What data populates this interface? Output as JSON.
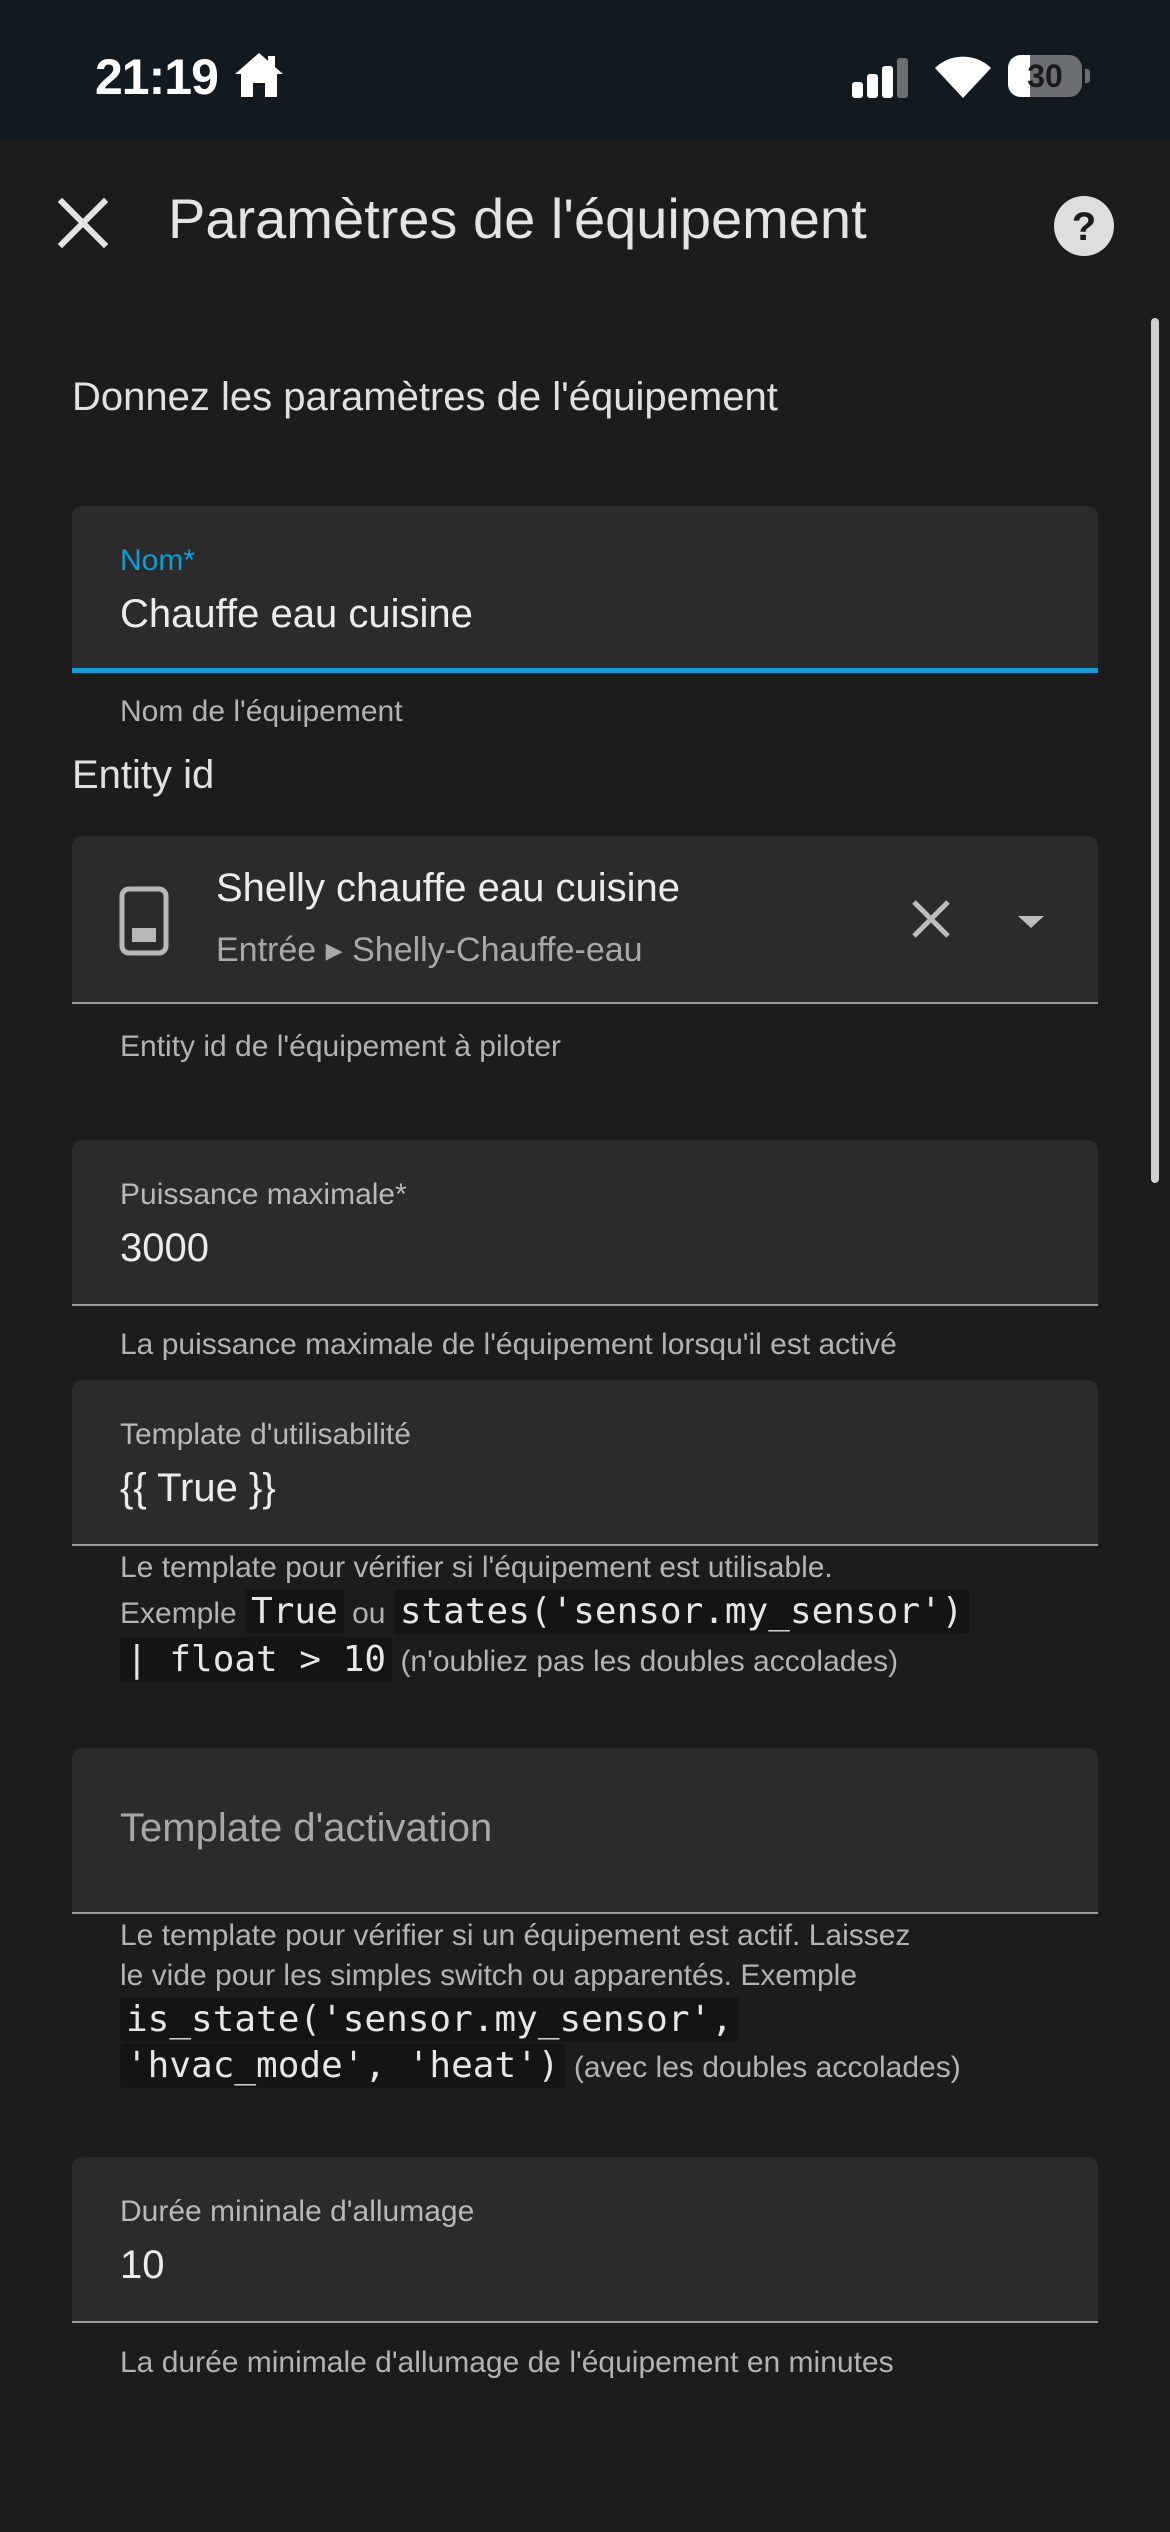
{
  "status": {
    "time": "21:19",
    "battery": "30",
    "battery_level": 0.3
  },
  "header": {
    "title": "Paramètres de l'équipement"
  },
  "form": {
    "section_title": "Donnez les paramètres de l'équipement",
    "name": {
      "label": "Nom*",
      "value": "Chauffe eau cuisine",
      "helper": "Nom de l'équipement"
    },
    "entity": {
      "title": "Entity id",
      "name": "Shelly chauffe eau cuisine",
      "subtitle": "Entrée ▸ Shelly-Chauffe-eau",
      "helper": "Entity id de l'équipement à piloter"
    },
    "power": {
      "label": "Puissance maximale*",
      "value": "3000",
      "helper": "La puissance maximale de l'équipement lorsqu'il est activé"
    },
    "usability": {
      "label": "Template d'utilisabilité",
      "value": "{{ True }}",
      "helper_line1": "Le template pour vérifier si l'équipement est utilisable.",
      "helper_example": "Exemple",
      "code1": "True",
      "helper_or": "ou",
      "code2": "states('sensor.my_sensor')",
      "code3": "| float > 10",
      "helper_tail": "(n'oubliez pas les doubles accolades)"
    },
    "activation": {
      "placeholder": "Template d'activation",
      "helper_line1": "Le template pour vérifier si un équipement est actif. Laissez",
      "helper_line2": "le vide pour les simples switch ou apparentés. Exemple",
      "code1": "is_state('sensor.my_sensor',",
      "code2": "'hvac_mode', 'heat')",
      "helper_tail": "(avec les doubles accolades)"
    },
    "duration": {
      "label": "Durée mininale d'allumage",
      "value": "10",
      "helper": "La durée minimale d'allumage de l'équipement en minutes"
    }
  }
}
